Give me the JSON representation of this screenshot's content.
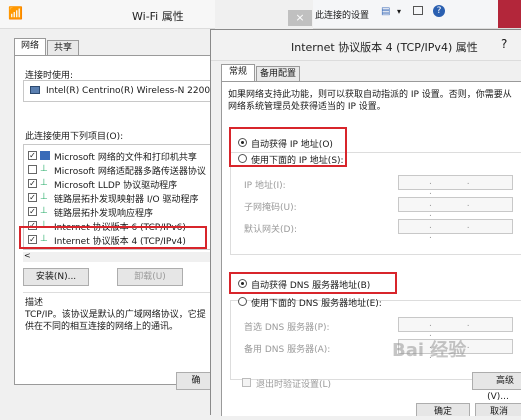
{
  "left_dialog": {
    "title": "Wi-Fi 属性",
    "tabs": [
      "网络",
      "共享"
    ],
    "connect_using_label": "连接时使用:",
    "adapter_name": "Intel(R) Centrino(R) Wireless-N 2200",
    "items_label": "此连接使用下列项目(O):",
    "items": [
      {
        "label": "Microsoft 网络的文件和打印机共享",
        "checked": true
      },
      {
        "label": "Microsoft 网络适配器多路传送器协议",
        "checked": false
      },
      {
        "label": "Microsoft LLDP 协议驱动程序",
        "checked": true
      },
      {
        "label": "链路层拓扑发现映射器 I/O 驱动程序",
        "checked": true
      },
      {
        "label": "链路层拓扑发现响应程序",
        "checked": true
      },
      {
        "label": "Internet 协议版本 6 (TCP/IPv6)",
        "checked": true
      },
      {
        "label": "Internet 协议版本 4 (TCP/IPv4)",
        "checked": true
      }
    ],
    "install_button": "安装(N)...",
    "uninstall_button": "卸载(U)",
    "description_title": "描述",
    "description_text": "TCP/IP。该协议是默认的广域网络协议，它提供在不同的相互连接的网络上的通讯。",
    "ok_button": "确",
    "close_symbol": "×"
  },
  "toolbar": {
    "text": "此连接的设置"
  },
  "right_dialog": {
    "title": "Internet 协议版本 4 (TCP/IPv4) 属性",
    "help_symbol": "?",
    "tabs": [
      "常规",
      "备用配置"
    ],
    "intro": "如果网络支持此功能，则可以获取自动指派的 IP 设置。否则，你需要从网络系统管理员处获得适当的 IP 设置。",
    "ip_auto": "自动获得 IP 地址(O)",
    "ip_manual": "使用下面的 IP 地址(S):",
    "ip_label": "IP 地址(I):",
    "mask_label": "子网掩码(U):",
    "gateway_label": "默认网关(D):",
    "dns_auto": "自动获得 DNS 服务器地址(B)",
    "dns_manual": "使用下面的 DNS 服务器地址(E):",
    "dns_pref_label": "首选 DNS 服务器(P):",
    "dns_alt_label": "备用 DNS 服务器(A):",
    "validate_label": "退出时验证设置(L)",
    "advanced_button": "高级(V)...",
    "ok_button": "确定",
    "cancel_button": "取消",
    "ip_dots": ". . ."
  },
  "watermark": "Bai 经验",
  "colors": {
    "highlight": "#d8252b",
    "window_bg": "#f0f0f0",
    "panel_bg": "#ffffff"
  }
}
